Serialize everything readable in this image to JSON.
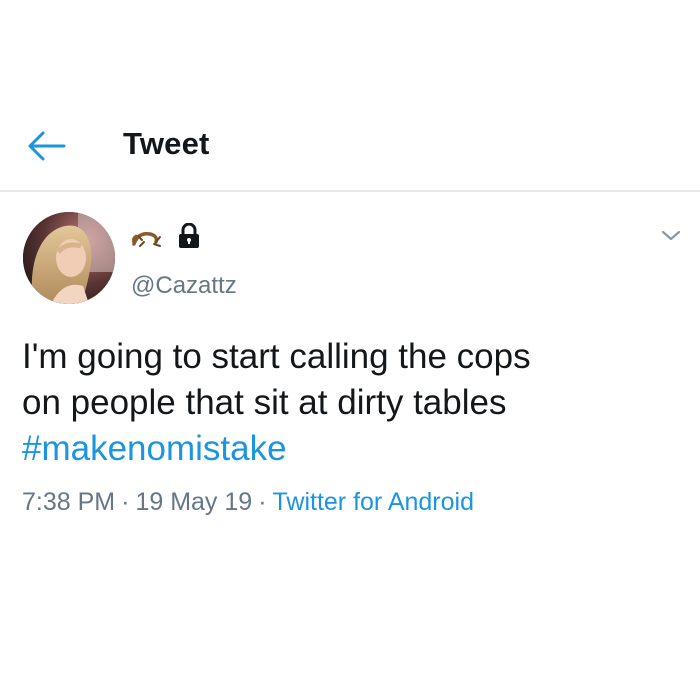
{
  "header": {
    "title": "Tweet",
    "back_icon": "arrow-left-icon",
    "accent_color": "#1b95e0"
  },
  "tweet": {
    "display_name_icons": [
      "scorpion-icon",
      "lock-icon"
    ],
    "handle": "@Cazattz",
    "text_lines": [
      "I'm going to start calling the cops",
      "on people that sit at dirty tables"
    ],
    "hashtag": "#makenomistake",
    "time": "7:38 PM",
    "separator": "·",
    "date": "19 May 19",
    "source": "Twitter for Android",
    "caret_icon": "chevron-down-icon"
  },
  "colors": {
    "text_primary": "#14171a",
    "text_secondary": "#657786",
    "link": "#1b95e0",
    "divider": "#e6e9ec"
  }
}
